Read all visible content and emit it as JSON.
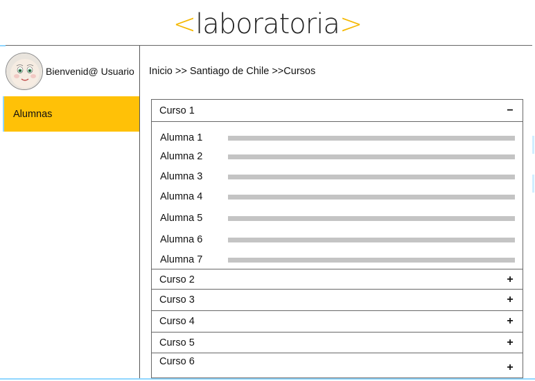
{
  "header": {
    "logo_text": "laboratoria",
    "logo_open": "<",
    "logo_close": ">"
  },
  "user": {
    "greeting": "Bienvenid@ Usuario"
  },
  "sidebar": {
    "items": [
      {
        "label": "Alumnas"
      }
    ]
  },
  "breadcrumb": {
    "text": "Inicio >> Santiago de Chile >>Cursos"
  },
  "courses": [
    {
      "label": "Curso 1",
      "toggle": "−",
      "expanded": true,
      "students": [
        "Alumna 1",
        "Alumna 2",
        "Alumna 3",
        "Alumna 4",
        "Alumna 5",
        "Alumna 6",
        "Alumna 7"
      ]
    },
    {
      "label": "Curso 2",
      "toggle": "+"
    },
    {
      "label": "Curso 3",
      "toggle": "+"
    },
    {
      "label": "Curso 4",
      "toggle": "+"
    },
    {
      "label": "Curso 5",
      "toggle": "+"
    },
    {
      "label": "Curso 6",
      "toggle": "+"
    }
  ],
  "colors": {
    "accent": "#ffc107",
    "logo_bracket": "#f5b800",
    "divider_blue": "#8fd6ff",
    "bar": "#c4c4c4"
  }
}
